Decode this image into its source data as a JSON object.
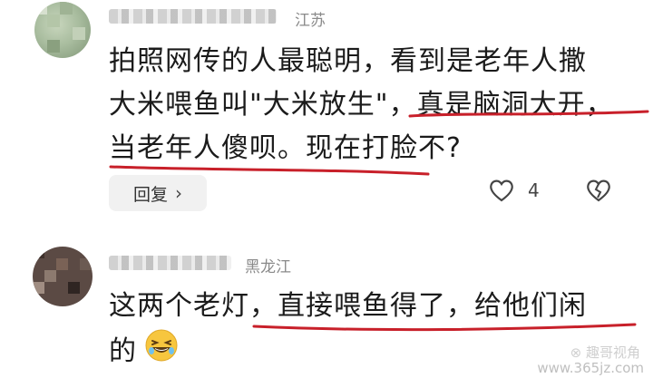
{
  "comments": [
    {
      "location": "江苏",
      "lines": [
        "拍照网传的人最聪明，看到是老年人撒",
        "大米喂鱼叫\"大米放生\"，真是脑洞大开，",
        "当老年人傻呗。现在打脸不?"
      ],
      "reply_label": "回复",
      "like_count": "4"
    },
    {
      "location": "黑龙江",
      "lines": [
        "这两个老灯，直接喂鱼得了，给他们闲",
        "的"
      ]
    }
  ],
  "watermark": {
    "line1": "⊗ 趣哥视角",
    "line2": "www.365jz.com"
  },
  "colors": {
    "underline": "#c8202a",
    "text": "#1b1b1b",
    "location": "#8a8a8a",
    "reply_bg": "#f1f1f1"
  },
  "icons": [
    "reply-chevron-icon",
    "heart-like-icon",
    "broken-heart-icon",
    "laughing-emoji-icon"
  ]
}
